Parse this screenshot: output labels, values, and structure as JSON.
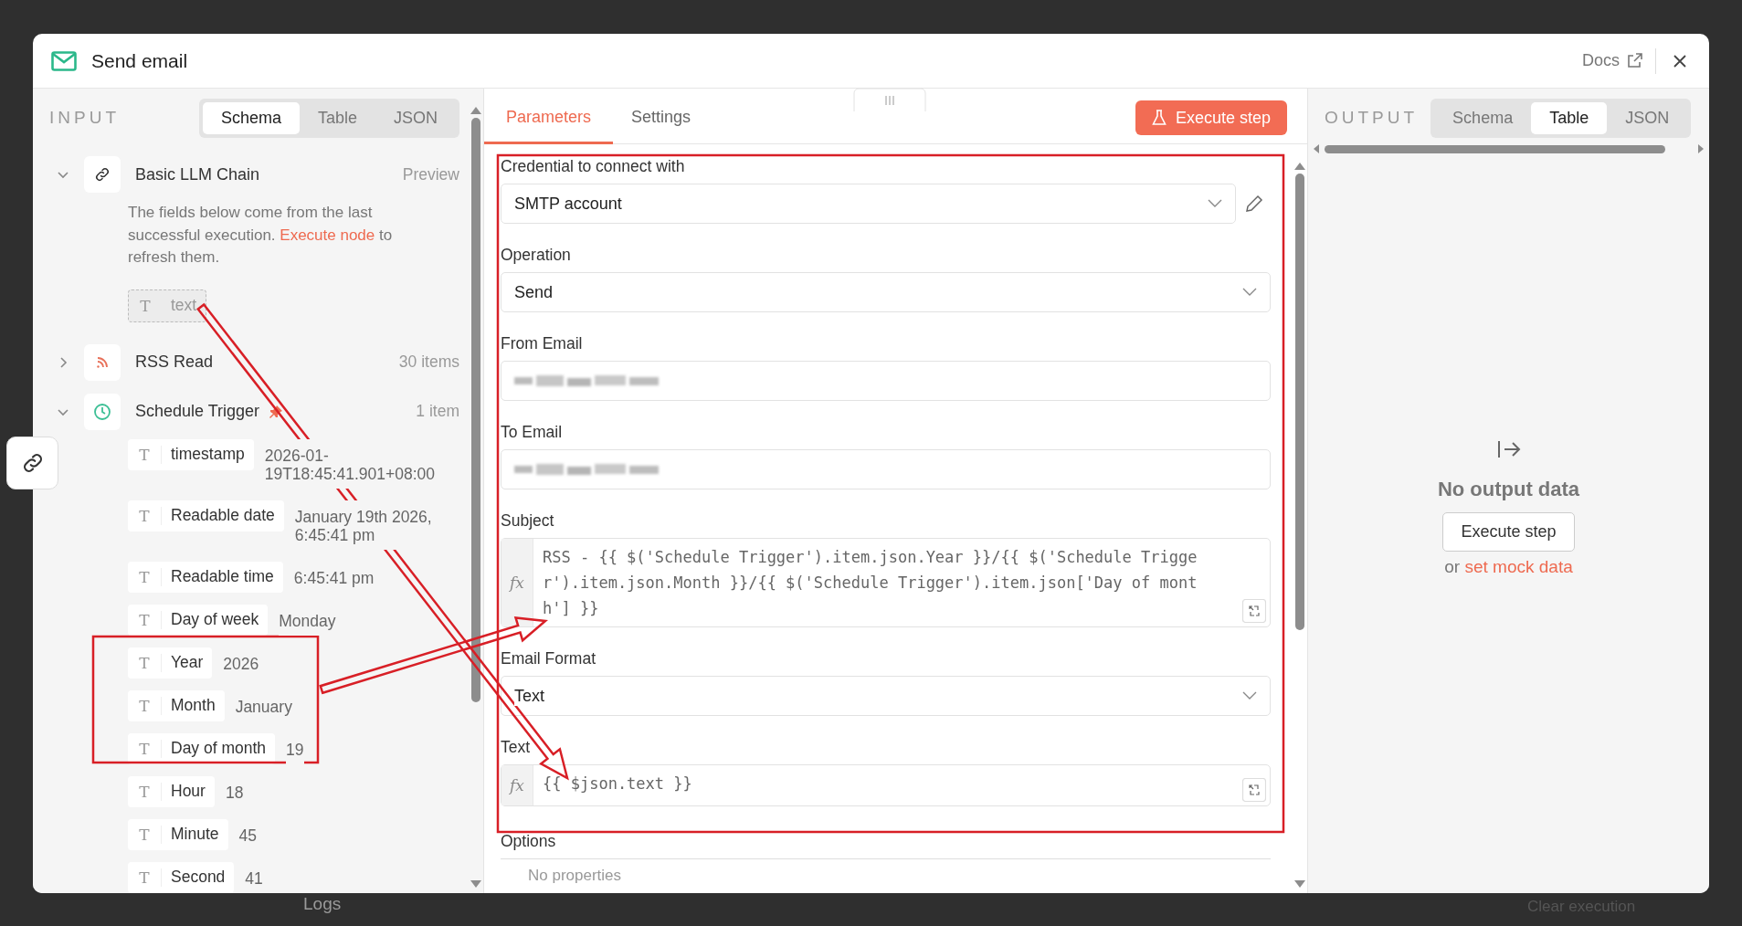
{
  "window": {
    "title": "Send email",
    "docs_link": "Docs"
  },
  "input": {
    "heading": "INPUT",
    "view_tabs": [
      {
        "label": "Schema",
        "selected": true
      },
      {
        "label": "Table",
        "selected": false
      },
      {
        "label": "JSON",
        "selected": false
      }
    ],
    "nodes": [
      {
        "name": "Basic LLM Chain",
        "expanded": true,
        "meta": "Preview",
        "note_before": "The fields below come from the last successful execution.",
        "note_link": "Execute node",
        "note_after": "to refresh them.",
        "fields": [
          {
            "kind": "placeholder",
            "type_glyph": "T",
            "name": "text"
          }
        ]
      },
      {
        "name": "RSS Read",
        "expanded": false,
        "meta": "30 items"
      },
      {
        "name": "Schedule Trigger",
        "expanded": true,
        "pinned": true,
        "meta": "1 item",
        "fields": [
          {
            "kind": "field",
            "type_glyph": "T",
            "name": "timestamp",
            "value": "2026-01-19T18:45:41.901+08:00"
          },
          {
            "kind": "field",
            "type_glyph": "T",
            "name": "Readable date",
            "value": "January 19th 2026, 6:45:41 pm"
          },
          {
            "kind": "field",
            "type_glyph": "T",
            "name": "Readable time",
            "value": "6:45:41 pm"
          },
          {
            "kind": "field",
            "type_glyph": "T",
            "name": "Day of week",
            "value": "Monday"
          },
          {
            "kind": "field",
            "type_glyph": "T",
            "name": "Year",
            "value": "2026"
          },
          {
            "kind": "field",
            "type_glyph": "T",
            "name": "Month",
            "value": "January"
          },
          {
            "kind": "field",
            "type_glyph": "T",
            "name": "Day of month",
            "value": "19"
          },
          {
            "kind": "field",
            "type_glyph": "T",
            "name": "Hour",
            "value": "18"
          },
          {
            "kind": "field",
            "type_glyph": "T",
            "name": "Minute",
            "value": "45"
          },
          {
            "kind": "field",
            "type_glyph": "T",
            "name": "Second",
            "value": "41"
          }
        ]
      }
    ]
  },
  "parameters": {
    "tabs": [
      {
        "label": "Parameters",
        "selected": true
      },
      {
        "label": "Settings",
        "selected": false
      }
    ],
    "execute_button": "Execute step",
    "fields": [
      {
        "kind": "select",
        "label": "Credential to connect with",
        "value": "SMTP account",
        "editable": true
      },
      {
        "kind": "select",
        "label": "Operation",
        "value": "Send"
      },
      {
        "kind": "redacted",
        "label": "From Email"
      },
      {
        "kind": "redacted",
        "label": "To Email"
      },
      {
        "kind": "expression",
        "label": "Subject",
        "badge": "fx",
        "value": "RSS - {{ $('Schedule Trigger').item.json.Year }}/{{ $('Schedule Trigger').item.json.Month }}/{{ $('Schedule Trigger').item.json['Day of month'] }}"
      },
      {
        "kind": "select",
        "label": "Email Format",
        "value": "Text"
      },
      {
        "kind": "expression",
        "label": "Text",
        "badge": "fx",
        "value": "{{ $json.text }}"
      }
    ],
    "options_heading": "Options",
    "options_empty": "No properties"
  },
  "output": {
    "heading": "OUTPUT",
    "view_tabs": [
      {
        "label": "Schema",
        "selected": false
      },
      {
        "label": "Table",
        "selected": true
      },
      {
        "label": "JSON",
        "selected": false
      }
    ],
    "empty_title": "No output data",
    "execute_button": "Execute step",
    "mock_prefix": "or",
    "mock_link": "set mock data"
  },
  "background": {
    "logs_label": "Logs",
    "clear_label": "Clear execution"
  }
}
